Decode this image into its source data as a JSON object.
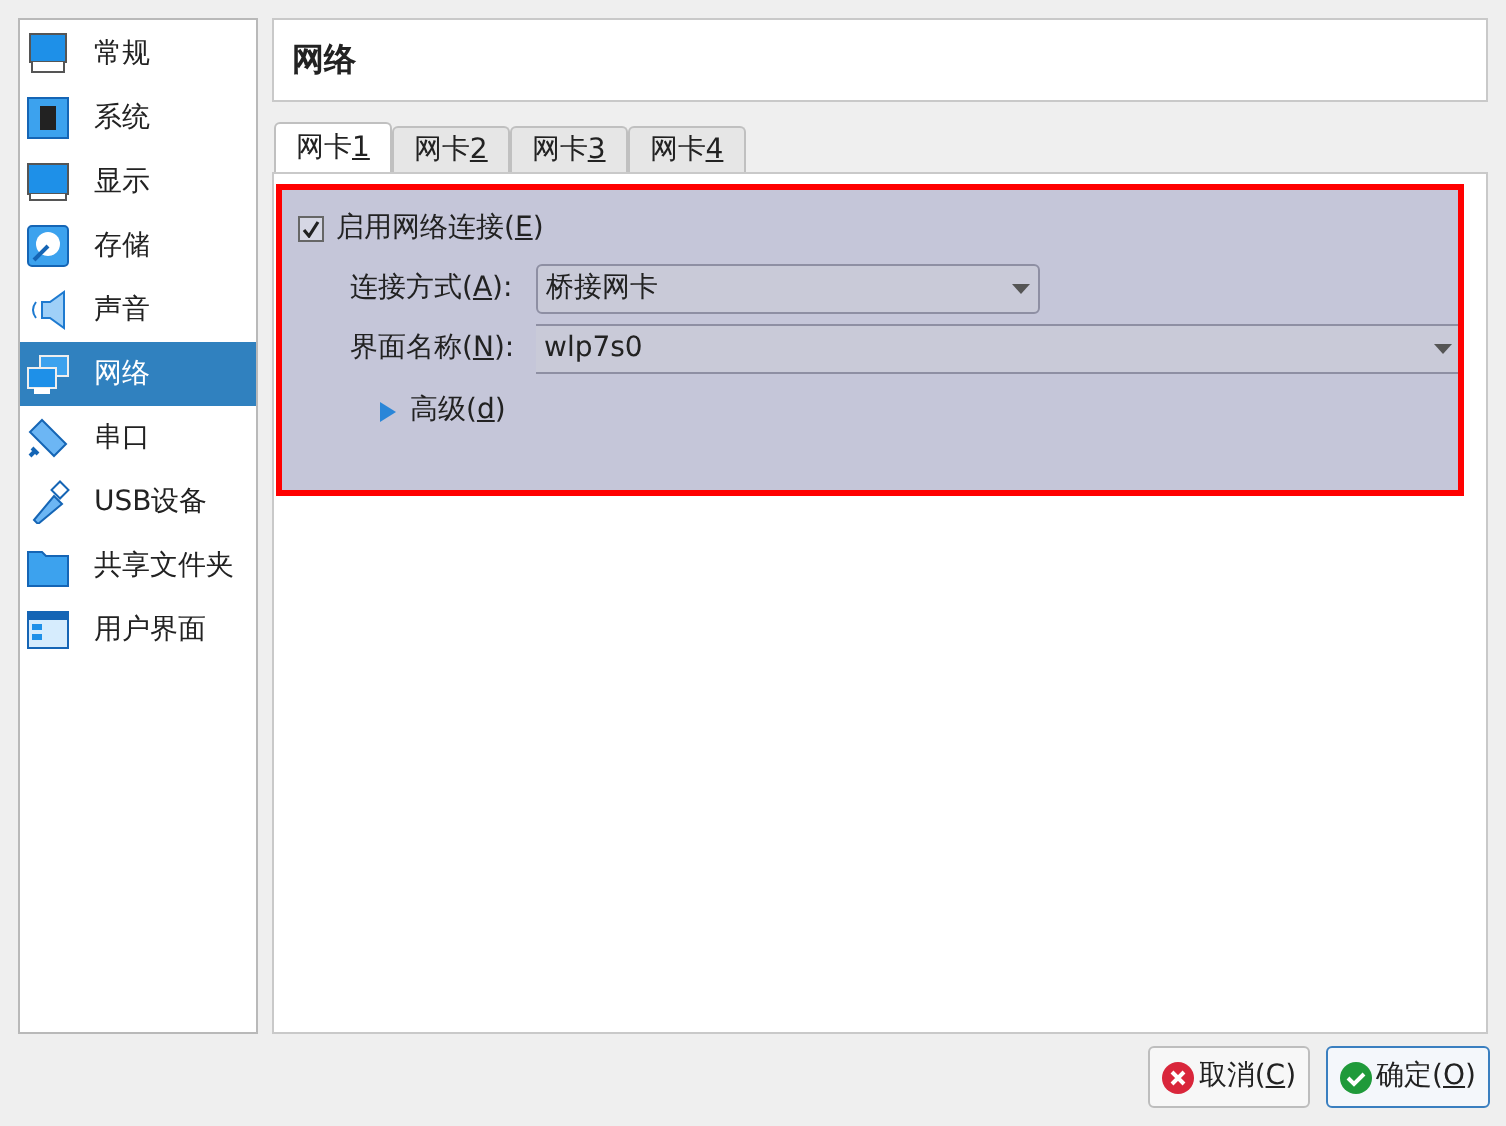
{
  "sidebar": {
    "items": [
      {
        "label": "常规",
        "selected": false
      },
      {
        "label": "系统",
        "selected": false
      },
      {
        "label": "显示",
        "selected": false
      },
      {
        "label": "存储",
        "selected": false
      },
      {
        "label": "声音",
        "selected": false
      },
      {
        "label": "网络",
        "selected": true
      },
      {
        "label": "串口",
        "selected": false
      },
      {
        "label": "USB设备",
        "selected": false
      },
      {
        "label": "共享文件夹",
        "selected": false
      },
      {
        "label": "用户界面",
        "selected": false
      }
    ]
  },
  "page_title": "网络",
  "tabs": [
    {
      "label": {
        "pre": "网卡 ",
        "key": "1"
      },
      "selected": true
    },
    {
      "label": {
        "pre": "网卡 ",
        "key": "2"
      },
      "selected": false
    },
    {
      "label": {
        "pre": "网卡 ",
        "key": "3"
      },
      "selected": false
    },
    {
      "label": {
        "pre": "网卡 ",
        "key": "4"
      },
      "selected": false
    }
  ],
  "adapter": {
    "enable": {
      "label": {
        "pre": "启用网络连接(",
        "key": "E",
        "post": ")"
      },
      "checked": true
    },
    "attached_to": {
      "label": {
        "pre": "连接方式(",
        "key": "A",
        "post": "):"
      },
      "value": "桥接网卡"
    },
    "name": {
      "label": {
        "pre": "界面名称(",
        "key": "N",
        "post": "):"
      },
      "value": "wlp7s0"
    },
    "advanced": {
      "label": {
        "pre": "高级(",
        "key": "d",
        "post": ")"
      },
      "expanded": false
    }
  },
  "buttons": [
    {
      "kind": "cancel",
      "label": {
        "pre": "取消(",
        "key": "C",
        "post": ")"
      }
    },
    {
      "kind": "ok",
      "label": {
        "pre": "确定(",
        "key": "O",
        "post": ")"
      }
    }
  ]
}
